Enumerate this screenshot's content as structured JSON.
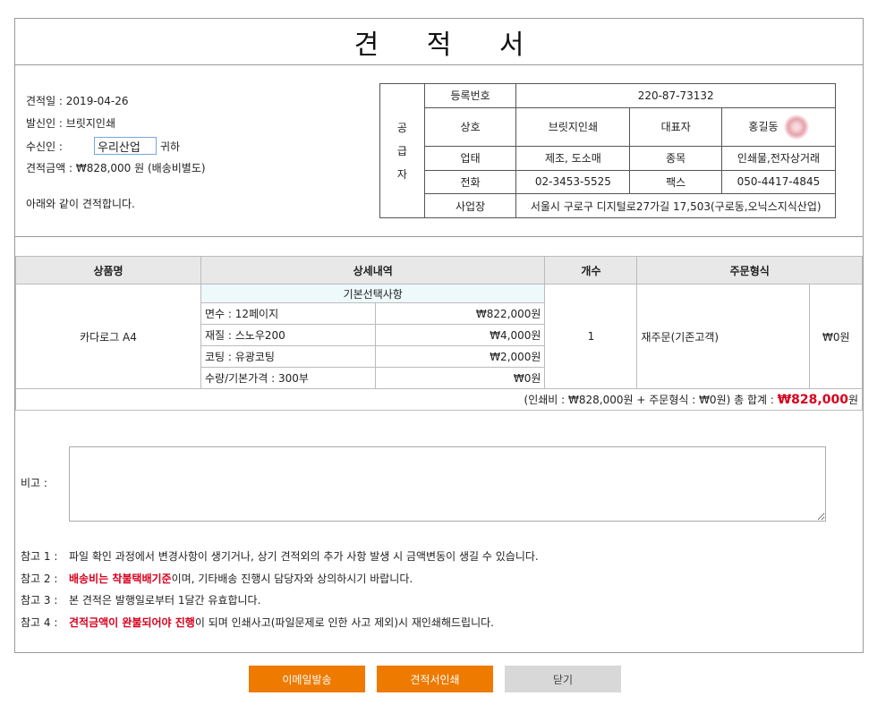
{
  "title": "견 적 서",
  "estimate": {
    "date_label": "견적일 : 2019-04-26",
    "sender_label": "발신인 : 브릿지인쇄",
    "recipient_prefix": "수신인 :",
    "recipient_value": "우리산업",
    "recipient_suffix": "귀하",
    "amount_label": "견적금액 : ₩828,000 원 (배송비별도)",
    "intro": "아래와 같이 견적합니다."
  },
  "supplier": {
    "vertical_label": [
      "공",
      "급",
      "자"
    ],
    "reg_no_label": "등록번호",
    "reg_no": "220-87-73132",
    "company_label": "상호",
    "company": "브릿지인쇄",
    "ceo_label": "대표자",
    "ceo": "홍길동",
    "business_label": "업태",
    "business": "제조, 도소매",
    "category_label": "종목",
    "category": "인쇄물,전자상거래",
    "phone_label": "전화",
    "phone": "02-3453-5525",
    "fax_label": "팩스",
    "fax": "050-4417-4845",
    "address_label": "사업장",
    "address": "서울시 구로구 디지털로27가길 17,503(구로동,오닉스지식산업)"
  },
  "items": {
    "headers": [
      "상품명",
      "상세내역",
      "개수",
      "주문형식"
    ],
    "product": "카다로그 A4",
    "detail_heading": "기본선택사항",
    "details": [
      {
        "name": "면수 : 12페이지",
        "price": "₩822,000원"
      },
      {
        "name": "재질 : 스노우200",
        "price": "₩4,000원"
      },
      {
        "name": "코팅 : 유광코팅",
        "price": "₩2,000원"
      },
      {
        "name": "수량/기본가격 : 300부",
        "price": "₩0원"
      }
    ],
    "quantity": "1",
    "order_type": "재주문(기존고객)",
    "order_price": "₩0원",
    "summary": "(인쇄비 : ₩828,000원 + 주문형식 : ₩0원)  총 합계 :",
    "total": "₩828,000",
    "total_unit": "원"
  },
  "notes": {
    "label": "비고 :"
  },
  "references": [
    {
      "key": "참고 1 :",
      "red": "",
      "text": "파일 확인 과정에서 변경사항이 생기거나, 상기 견적외의 추가 사항 발생 시 금액변동이 생길 수 있습니다."
    },
    {
      "key": "참고 2 :",
      "red": "배송비는 착불택배기준",
      "text": "이며, 기타배송 진행시 담당자와 상의하시기 바랍니다."
    },
    {
      "key": "참고 3 :",
      "red": "",
      "text": "본 견적은 발행일로부터 1달간 유효합니다."
    },
    {
      "key": "참고 4 :",
      "red": "견적금액이 완불되어야 진행",
      "text": "이 되며 인쇄사고(파일문제로 인한 사고 제외)시 재인쇄해드립니다."
    }
  ],
  "buttons": {
    "email": "이메일발송",
    "print": "견적서인쇄",
    "close": "닫기"
  },
  "colors": {
    "accent_orange": "#ee7a00",
    "total_red": "#d8001c",
    "header_gray": "#e8e8e8"
  }
}
